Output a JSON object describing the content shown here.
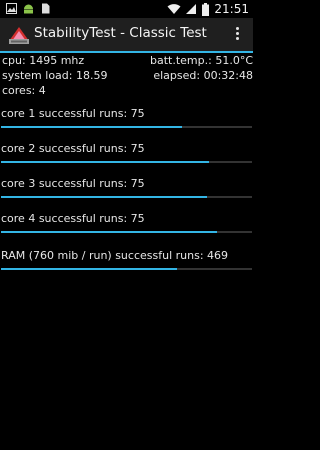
{
  "status_bar": {
    "time": "21:51",
    "icons": [
      "image-icon",
      "android-icon",
      "sd-card-icon",
      "wifi-icon",
      "signal-icon",
      "battery-icon"
    ]
  },
  "action_bar": {
    "title": "StabilityTest - Classic Test",
    "icon": "stability-test-app-icon",
    "menu": "overflow-menu-icon"
  },
  "info": {
    "cpu": "cpu: 1495 mhz",
    "batt_temp": "batt.temp.: 51.0°C",
    "system_load": "system load: 18.59",
    "elapsed": "elapsed: 00:32:48",
    "cores": "cores: 4"
  },
  "tests": [
    {
      "label": "core 1 successful runs: 75",
      "progress": 0.72
    },
    {
      "label": "core 2 successful runs: 75",
      "progress": 0.83
    },
    {
      "label": "core 3 successful runs: 75",
      "progress": 0.82
    },
    {
      "label": "core 4 successful runs: 75",
      "progress": 0.86
    },
    {
      "label": "RAM (760 mib / run) successful runs: 469",
      "progress": 0.7
    }
  ],
  "colors": {
    "accent": "#33b5e5",
    "background": "#000000",
    "action_bar": "#1f1f1f",
    "track": "#333333"
  }
}
